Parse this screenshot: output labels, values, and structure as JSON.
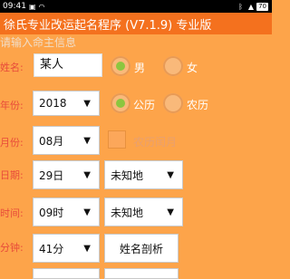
{
  "status_bar": {
    "time": "09:41",
    "battery": "70",
    "icons": [
      "photo-icon",
      "wifi-icon",
      "bluetooth-icon",
      "signal-icon",
      "battery-icon"
    ]
  },
  "app": {
    "title": "徐氏专业改运起名程序 (V7.1.9)  专业版",
    "hint": "请输入命主信息"
  },
  "form": {
    "name_label": "姓名:",
    "name_value": "某人",
    "gender": {
      "male": "男",
      "female": "女",
      "selected": "male"
    },
    "year_label": "年份:",
    "year_value": "2018",
    "calendar": {
      "solar": "公历",
      "lunar": "农历",
      "selected": "solar"
    },
    "month_label": "月份:",
    "month_value": "08月",
    "leap_label": "农历闰月",
    "leap_checked": false,
    "day_label": "日期:",
    "day_value": "29日",
    "place_value": "未知地",
    "hour_label": "时间:",
    "hour_value": "09时",
    "hour_place_value": "未知地",
    "minute_label": "分钟:",
    "minute_value": "41分",
    "analyze_button": "姓名剖析"
  },
  "colors": {
    "background": "#FDA44A",
    "titlebar": "#F4711E",
    "label": "#E84B3A",
    "radio_selected": "#8CC63F"
  }
}
